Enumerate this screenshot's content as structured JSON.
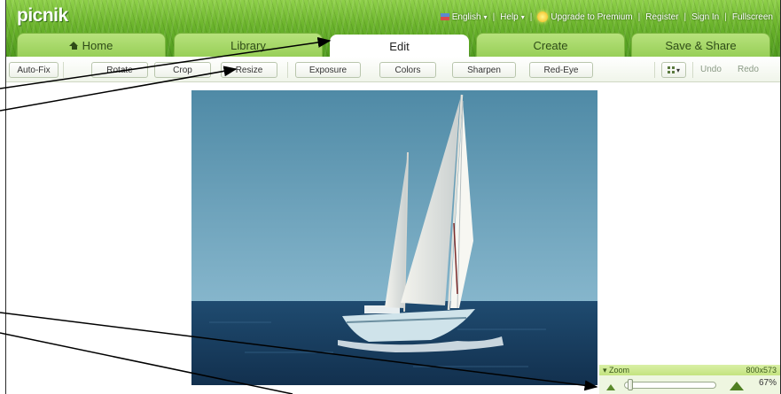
{
  "app": {
    "logo_text": "picnik"
  },
  "top_nav": {
    "language": "English",
    "help": "Help",
    "upgrade": "Upgrade to Premium",
    "register": "Register",
    "sign_in": "Sign In",
    "fullscreen": "Fullscreen",
    "separator": "|",
    "caret": "▾"
  },
  "tabs": [
    {
      "label": "Home",
      "icon": "home-icon"
    },
    {
      "label": "Library"
    },
    {
      "label": "Edit",
      "active": true
    },
    {
      "label": "Create"
    },
    {
      "label": "Save & Share"
    }
  ],
  "toolbar": {
    "auto_fix": "Auto-Fix",
    "rotate": "Rotate",
    "crop": "Crop",
    "resize": "Resize",
    "exposure": "Exposure",
    "colors": "Colors",
    "sharpen": "Sharpen",
    "red_eye": "Red-Eye",
    "more_caret": "▾",
    "undo": "Undo",
    "redo": "Redo"
  },
  "zoom": {
    "title": "Zoom",
    "toggle": "▾",
    "dimensions": "800x573",
    "percent_label": "67%",
    "slider_level": 0.03
  },
  "colors": {
    "grass": "#6bb42c",
    "tab": "#a8d86a",
    "sky": "#5e9ab4",
    "sea": "#1e4a6e",
    "zoom_bar": "#cfe993"
  }
}
